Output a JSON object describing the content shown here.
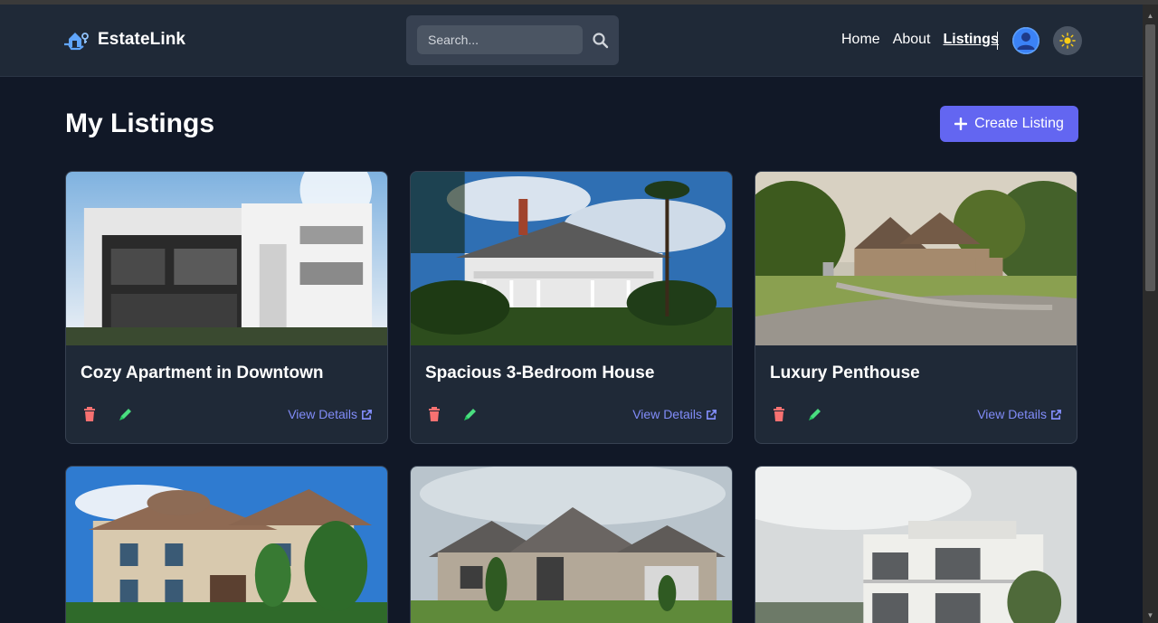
{
  "brand": {
    "name": "EstateLink",
    "logo_icon": "house-key-icon",
    "accent": "#60a5fa"
  },
  "search": {
    "placeholder": "Search...",
    "value": ""
  },
  "nav": {
    "home": "Home",
    "about": "About",
    "listings": "Listings"
  },
  "page": {
    "title": "My Listings",
    "create_label": "Create Listing"
  },
  "colors": {
    "background": "#111827",
    "card": "#1f2937",
    "primary": "#6366f1",
    "delete": "#f87171",
    "edit": "#4ade80",
    "link": "#818cf8"
  },
  "listings": [
    {
      "title": "Cozy Apartment in Downtown",
      "details_label": "View Details"
    },
    {
      "title": "Spacious 3-Bedroom House",
      "details_label": "View Details"
    },
    {
      "title": "Luxury Penthouse",
      "details_label": "View Details"
    },
    {
      "title": "",
      "details_label": ""
    },
    {
      "title": "",
      "details_label": ""
    },
    {
      "title": "",
      "details_label": ""
    }
  ]
}
